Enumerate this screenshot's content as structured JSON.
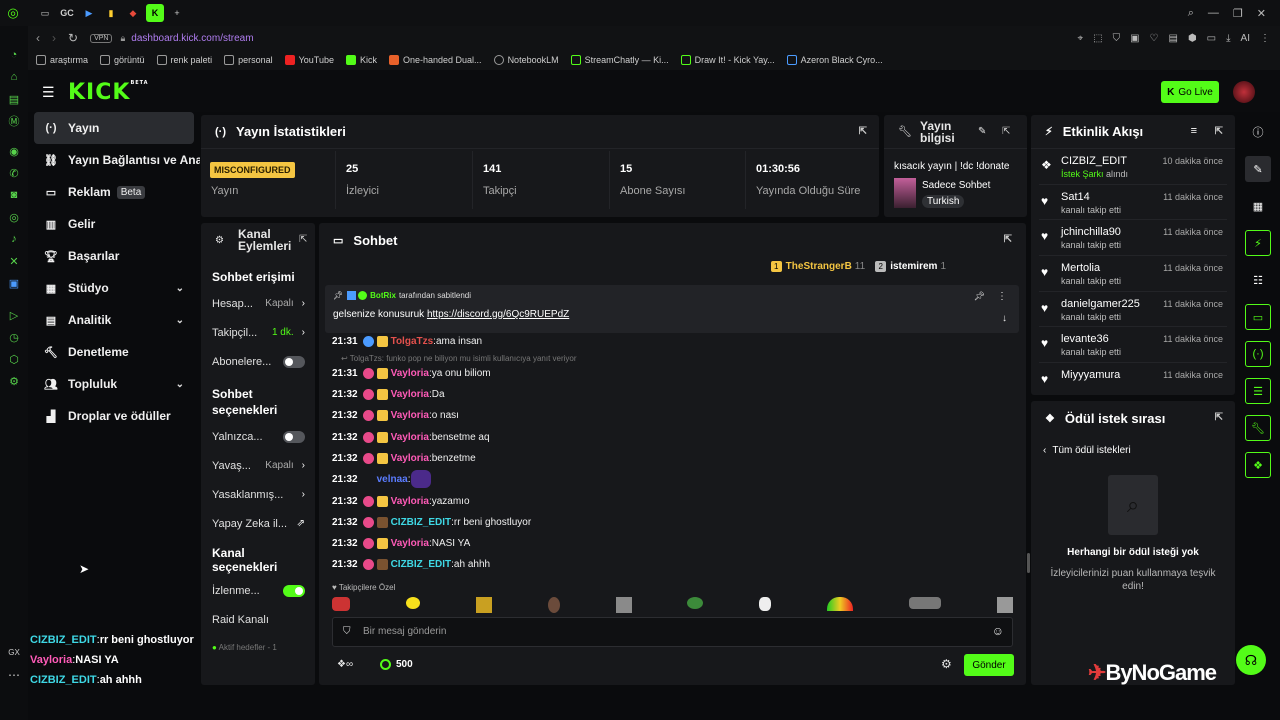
{
  "browser": {
    "tabs_icons": [
      "gx-icon",
      "gc-label",
      "play-icon",
      "bars-icon",
      "game-icon",
      "kick-icon",
      "plus-icon"
    ],
    "tab_gc": "GC",
    "url": "dashboard.kick.com/stream",
    "vpn": "VPN",
    "ai_label": "AI",
    "bookmarks": [
      "araştırma",
      "görüntü",
      "renk paleti",
      "personal",
      "YouTube",
      "Kick",
      "One-handed Dual...",
      "NotebookLM",
      "StreamChatly — Ki...",
      "Draw It! - Kick Yay...",
      "Azeron Black Cyro..."
    ]
  },
  "header": {
    "logo": "KICK",
    "logo_badge": "BETA",
    "go_live": "Go Live"
  },
  "nav": [
    {
      "label": "Yayın",
      "icon": "stream-icon",
      "active": true
    },
    {
      "label": "Yayın Bağlantısı ve Anahtar",
      "icon": "link-icon"
    },
    {
      "label": "Reklam",
      "icon": "ad-icon",
      "badge": "Beta"
    },
    {
      "label": "Gelir",
      "icon": "revenue-icon"
    },
    {
      "label": "Başarılar",
      "icon": "trophy-icon"
    },
    {
      "label": "Stüdyo",
      "icon": "studio-icon",
      "expandable": true
    },
    {
      "label": "Analitik",
      "icon": "analytics-icon",
      "expandable": true
    },
    {
      "label": "Denetleme",
      "icon": "moderation-icon"
    },
    {
      "label": "Topluluk",
      "icon": "community-icon",
      "expandable": true
    },
    {
      "label": "Droplar ve ödüller",
      "icon": "drops-icon"
    }
  ],
  "stats": {
    "title": "Yayın İstatistikleri",
    "status_badge": "MISCONFIGURED",
    "cells": [
      {
        "value": "",
        "label": "Yayın"
      },
      {
        "value": "25",
        "label": "İzleyici"
      },
      {
        "value": "141",
        "label": "Takipçi"
      },
      {
        "value": "15",
        "label": "Abone Sayısı"
      },
      {
        "value": "01:30:56",
        "label": "Yayında Olduğu Süre"
      }
    ]
  },
  "stream_info": {
    "title": "Yayın bilgisi",
    "stream_title": "kısacık yayın | !dc !donate",
    "category": "Sadece Sohbet",
    "language": "Turkish"
  },
  "activity": {
    "title": "Etkinlik Akışı",
    "items": [
      {
        "name": "CIZBIZ_EDIT",
        "action": "İstek Şarkı",
        "action_suffix": " alındı",
        "time": "10 dakika önce",
        "icon": "reward-icon"
      },
      {
        "name": "Sat14",
        "action": "kanalı takip etti",
        "time": "11 dakika önce",
        "icon": "heart-icon"
      },
      {
        "name": "jchinchilla90",
        "action": "kanalı takip etti",
        "time": "11 dakika önce",
        "icon": "heart-icon"
      },
      {
        "name": "Mertolia",
        "action": "kanalı takip etti",
        "time": "11 dakika önce",
        "icon": "heart-icon"
      },
      {
        "name": "danielgamer225",
        "action": "kanalı takip etti",
        "time": "11 dakika önce",
        "icon": "heart-icon"
      },
      {
        "name": "levante36",
        "action": "kanalı takip etti",
        "time": "11 dakika önce",
        "icon": "heart-icon"
      },
      {
        "name": "Miyyyamura",
        "action": "kanalı takip etti",
        "time": "11 dakika önce",
        "icon": "heart-icon"
      }
    ]
  },
  "rewards": {
    "title": "Ödül istek sırası",
    "back": "Tüm ödül istekleri",
    "empty_title": "Herhangi bir ödül isteği yok",
    "empty_desc": "İzleyicilerinizi puan kullanmaya teşvik edin!"
  },
  "channel_actions": {
    "title": "Kanal Eylemleri",
    "sec1": "Sohbet erişimi",
    "rows1": [
      {
        "label": "Hesap...",
        "value": "Kapalı",
        "control": "chevron"
      },
      {
        "label": "Takipçil...",
        "value": "1 dk.",
        "control": "chevron",
        "green": true
      },
      {
        "label": "Abonelere...",
        "value": "",
        "control": "toggle-off"
      }
    ],
    "sec2": "Sohbet seçenekleri",
    "rows2": [
      {
        "label": "Yalnızca...",
        "value": "",
        "control": "toggle-off"
      },
      {
        "label": "Yavaş...",
        "value": "Kapalı",
        "control": "chevron"
      },
      {
        "label": "Yasaklanmış...",
        "value": "",
        "control": "chevron"
      },
      {
        "label": "Yapay Zeka il...",
        "value": "",
        "control": "external"
      }
    ],
    "sec3": "Kanal seçenekleri",
    "rows3": [
      {
        "label": "İzlenme...",
        "value": "",
        "control": "toggle-on"
      },
      {
        "label": "Raid Kanalı",
        "value": "",
        "control": "none"
      }
    ],
    "footer": "Aktif hedefler - 1"
  },
  "chat": {
    "title": "Sohbet",
    "top_users": [
      {
        "rank": "1",
        "name": "TheStrangerB",
        "count": "11"
      },
      {
        "rank": "2",
        "name": "istemirem",
        "count": "1"
      }
    ],
    "pinned_by": "BotRix",
    "pinned_by_suffix": "tarafından sabitlendi",
    "pinned_text": "gelsenize konusuruk",
    "pinned_link": "https://discord.gg/6Qc9RUEPdZ",
    "reply_hint": "TolgaTzs: funko pop ne biliyon mu isimli kullanıcıya yanıt veriyor",
    "messages": [
      {
        "time": "21:31",
        "user": "TolgaTzs",
        "color": "#e4514d",
        "text": "ama insan"
      },
      {
        "time": "21:31",
        "user": "Vayloria",
        "color": "#ff5bb8",
        "text": "ya onu biliom"
      },
      {
        "time": "21:32",
        "user": "Vayloria",
        "color": "#ff5bb8",
        "text": "Da"
      },
      {
        "time": "21:32",
        "user": "Vayloria",
        "color": "#ff5bb8",
        "text": "o nası"
      },
      {
        "time": "21:32",
        "user": "Vayloria",
        "color": "#ff5bb8",
        "text": "bensetme aq"
      },
      {
        "time": "21:32",
        "user": "Vayloria",
        "color": "#ff5bb8",
        "text": "benzetme"
      },
      {
        "time": "21:32",
        "user": "velnaa",
        "color": "#5b7cff",
        "text": ""
      },
      {
        "time": "21:32",
        "user": "Vayloria",
        "color": "#ff5bb8",
        "text": "yazamıo"
      },
      {
        "time": "21:32",
        "user": "CIZBIZ_EDIT",
        "color": "#3fd9e6",
        "text": "rr beni ghostluyor"
      },
      {
        "time": "21:32",
        "user": "Vayloria",
        "color": "#ff5bb8",
        "text": "NASI YA"
      },
      {
        "time": "21:32",
        "user": "CIZBIZ_EDIT",
        "color": "#3fd9e6",
        "text": "ah ahhh"
      }
    ],
    "followers_only": "Takipçilere Özel",
    "placeholder": "Bir mesaj gönderin",
    "points": "500",
    "send": "Gönder"
  },
  "overlay": [
    {
      "user": "CIZBIZ_EDIT",
      "color": "#3fd9e6",
      "text": "rr beni ghostluyor"
    },
    {
      "user": "Vayloria",
      "color": "#ff5bb8",
      "text": "NASI YA"
    },
    {
      "user": "CIZBIZ_EDIT",
      "color": "#3fd9e6",
      "text": "ah ahhh"
    }
  ],
  "watermark": "ByNoGame",
  "gx_label": "GX",
  "colors": {
    "accent": "#53fc18",
    "panel": "#17181b",
    "bg": "#0a0b0d"
  }
}
